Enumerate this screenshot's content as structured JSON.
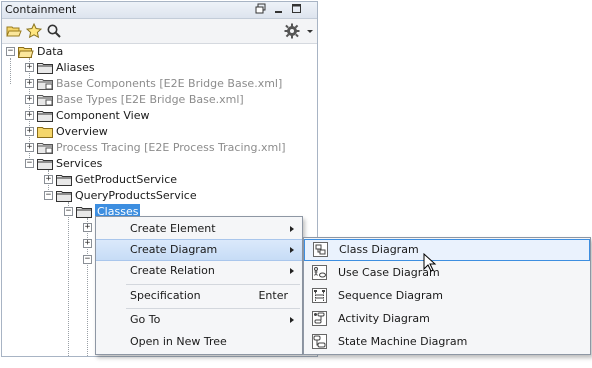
{
  "panel": {
    "title": "Containment",
    "toolbar_icons": [
      "open-folder-icon",
      "star-icon",
      "search-icon",
      "gear-icon",
      "dropdown-arrow-icon"
    ]
  },
  "tree": {
    "nodes": [
      {
        "label": "Data",
        "state": "expanded",
        "style": "normal"
      },
      {
        "label": "Aliases",
        "state": "collapsed",
        "style": "normal"
      },
      {
        "label": "Base Components [E2E Bridge Base.xml]",
        "state": "collapsed",
        "style": "dim"
      },
      {
        "label": "Base Types [E2E Bridge Base.xml]",
        "state": "collapsed",
        "style": "dim"
      },
      {
        "label": "Component View",
        "state": "collapsed",
        "style": "normal"
      },
      {
        "label": "Overview",
        "state": "collapsed",
        "style": "normal"
      },
      {
        "label": "Process Tracing [E2E Process Tracing.xml]",
        "state": "collapsed",
        "style": "dim"
      },
      {
        "label": "Services",
        "state": "expanded",
        "style": "normal"
      },
      {
        "label": "GetProductService",
        "state": "collapsed",
        "style": "normal"
      },
      {
        "label": "QueryProductsService",
        "state": "expanded",
        "style": "normal"
      },
      {
        "label": "Classes",
        "state": "expanded",
        "style": "selected"
      }
    ]
  },
  "context_menu": {
    "items": [
      {
        "label": "Create Element",
        "submenu": true,
        "shortcut": ""
      },
      {
        "label": "Create Diagram",
        "submenu": true,
        "shortcut": "",
        "highlighted": true
      },
      {
        "label": "Create Relation",
        "submenu": true,
        "shortcut": ""
      },
      {
        "label": "Specification",
        "submenu": false,
        "shortcut": "Enter"
      },
      {
        "label": "Go To",
        "submenu": true,
        "shortcut": ""
      },
      {
        "label": "Open in New Tree",
        "submenu": false,
        "shortcut": ""
      }
    ]
  },
  "submenu": {
    "items": [
      {
        "label": "Class Diagram",
        "icon": "class-diagram-icon",
        "highlighted": true
      },
      {
        "label": "Use Case Diagram",
        "icon": "use-case-diagram-icon"
      },
      {
        "label": "Sequence Diagram",
        "icon": "sequence-diagram-icon"
      },
      {
        "label": "Activity Diagram",
        "icon": "activity-diagram-icon"
      },
      {
        "label": "State Machine Diagram",
        "icon": "state-machine-diagram-icon"
      }
    ]
  },
  "colors": {
    "selection": "#3d8ee0",
    "menu_bg": "#f5f6f8",
    "highlight": "#c7dcf6",
    "folder_yellow": "#f5d66b"
  }
}
